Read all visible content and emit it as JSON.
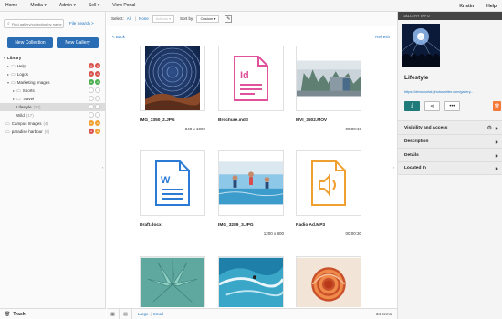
{
  "topnav": {
    "items": [
      "Home",
      "Media",
      "Admin",
      "Sell",
      "View Portal"
    ],
    "user": "Kristin",
    "help": "Help"
  },
  "sidebar": {
    "search_placeholder": "Find gallery/collection by name",
    "file_search": "File Search >",
    "new_collection": "New Collection",
    "new_gallery": "New Gallery",
    "tree": [
      {
        "label": "Library",
        "count": "",
        "bold": true
      },
      {
        "label": "Help",
        "count": ""
      },
      {
        "label": "Logos",
        "count": ""
      },
      {
        "label": "Marketing Images",
        "count": ""
      },
      {
        "label": "Sports",
        "count": ""
      },
      {
        "label": "Travel",
        "count": ""
      },
      {
        "label": "Lifestyle",
        "count": "(34)",
        "selected": true
      },
      {
        "label": "Wild",
        "count": "(17)"
      },
      {
        "label": "Campus Images",
        "count": "(4)"
      },
      {
        "label": "paradise harbour",
        "count": "(8)"
      }
    ],
    "trash": "Trash"
  },
  "toolbar": {
    "select_label": "Select:",
    "all": "All",
    "none": "None",
    "actions": "Actions",
    "sort_label": "Sort by:",
    "sort_value": "Custom"
  },
  "content": {
    "back": "< Back",
    "refresh": "Refresh",
    "files": [
      {
        "name": "IMG_3350_2.JPG",
        "meta": "840 x 1000"
      },
      {
        "name": "Brochure.indd",
        "meta": ""
      },
      {
        "name": "MVI_3502.MOV",
        "meta": "00:00:19"
      },
      {
        "name": "Draft.docx",
        "meta": ""
      },
      {
        "name": "IMG_3289_3.JPG",
        "meta": "1200 x 800"
      },
      {
        "name": "Radio Ad.MP3",
        "meta": "00:00:30"
      },
      {
        "name": "",
        "meta": ""
      },
      {
        "name": "",
        "meta": ""
      },
      {
        "name": "",
        "meta": ""
      }
    ],
    "size_large": "Large",
    "size_sep": "|",
    "size_small": "Small",
    "item_count": "34 items"
  },
  "info_panel": {
    "header": "GALLERY INFO",
    "title": "Lifestyle",
    "link": "https://demoportal.photoshelter.com/gallery...",
    "sections": [
      "Visibility and Access",
      "Description",
      "Details",
      "Located In"
    ]
  },
  "colors": {
    "accent": "#2a6db5",
    "teal": "#1f7a7a",
    "delete": "#f47a3a",
    "indd": "#e0529c",
    "docx": "#2b7bd6",
    "mp3": "#f0a030"
  }
}
